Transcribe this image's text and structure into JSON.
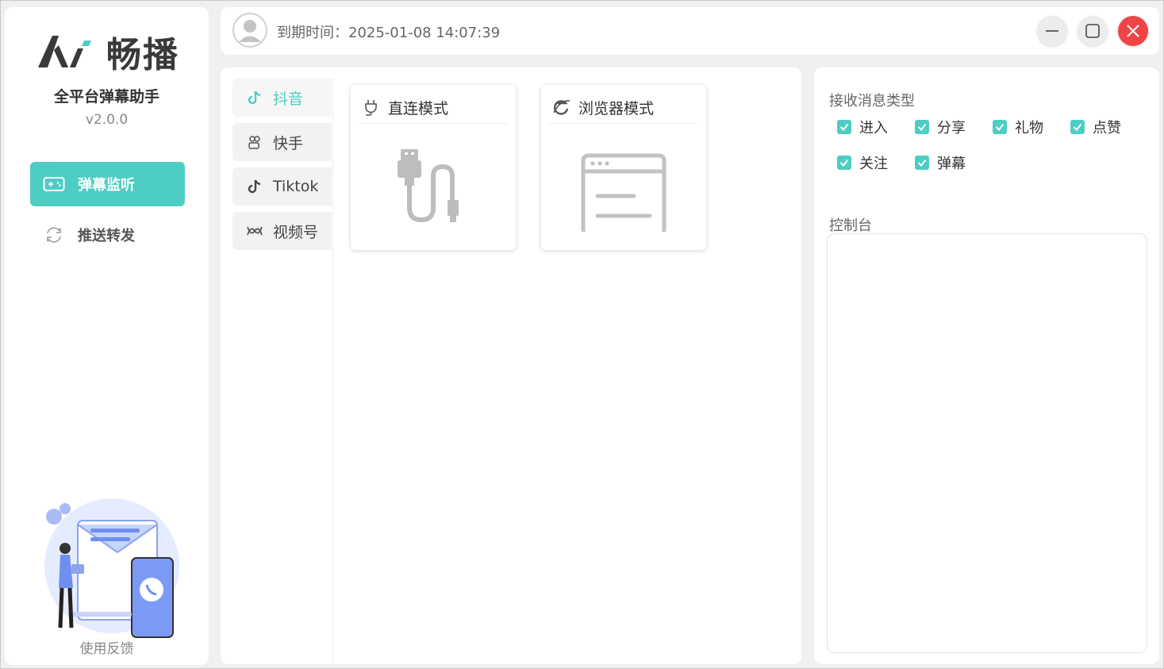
{
  "app": {
    "logo_text": "畅播",
    "subtitle": "全平台弹幕助手",
    "version": "v2.0.0"
  },
  "nav": [
    {
      "label": "弹幕监听",
      "icon": "gamepad-icon",
      "active": true
    },
    {
      "label": "推送转发",
      "icon": "refresh-icon",
      "active": false
    }
  ],
  "feedback_label": "使用反馈",
  "header": {
    "expire_label": "到期时间：2025-01-08 14:07:39"
  },
  "platforms": [
    {
      "label": "抖音",
      "icon": "douyin-icon",
      "active": true
    },
    {
      "label": "快手",
      "icon": "kuaishou-icon",
      "active": false
    },
    {
      "label": "Tiktok",
      "icon": "tiktok-icon",
      "active": false
    },
    {
      "label": "视频号",
      "icon": "channels-icon",
      "active": false
    }
  ],
  "modes": [
    {
      "label": "直连模式",
      "icon": "plug-icon"
    },
    {
      "label": "浏览器模式",
      "icon": "ie-browser-icon"
    }
  ],
  "message_types": {
    "title": "接收消息类型",
    "items": [
      {
        "label": "进入",
        "checked": true
      },
      {
        "label": "分享",
        "checked": true
      },
      {
        "label": "礼物",
        "checked": true
      },
      {
        "label": "点赞",
        "checked": true
      },
      {
        "label": "关注",
        "checked": true
      },
      {
        "label": "弹幕",
        "checked": true
      }
    ]
  },
  "console": {
    "title": "控制台",
    "content": ""
  },
  "colors": {
    "accent": "#4ecdc4",
    "close": "#f14545",
    "background": "#f0f0f0"
  }
}
